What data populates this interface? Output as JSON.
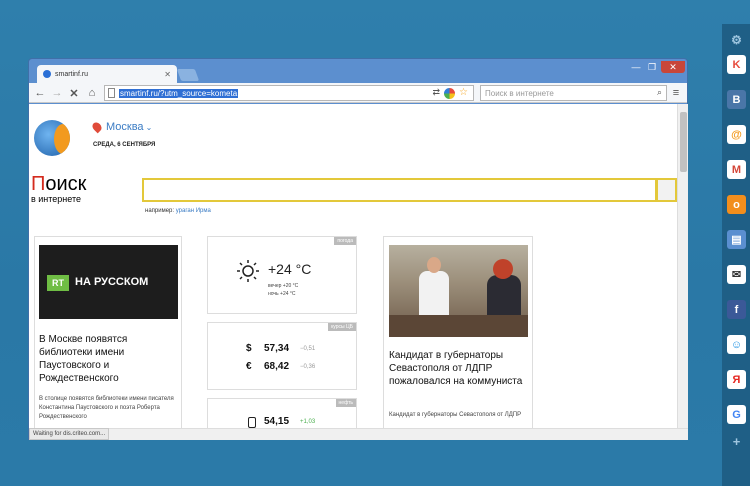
{
  "browser": {
    "tab_title": "smartinf.ru",
    "url_selected": "smartinf.ru/?utm_source=kometa",
    "search_placeholder": "Поиск в интернете",
    "status_text": "Waiting for dis.criteo.com..."
  },
  "page": {
    "city": "Москва",
    "date": "СРЕДА, 6 СЕНТЯБРЯ",
    "search_logo_main": "оиск",
    "search_logo_first": "П",
    "search_logo_sub": "в интернете",
    "example_label": "например:",
    "example_link": "ураган Ирма"
  },
  "news1": {
    "badge_text": "НА РУССКОМ",
    "badge_logo": "RT",
    "headline": "В Москве появятся библиотеки имени Паустовского и Рождественского",
    "lead": "В столице появятся библиотеки имени писателя Константина Паустовского и поэта Роберта Рождественского"
  },
  "weather": {
    "tag": "погода",
    "temp": "+24 °C",
    "evening": "вечер +20 °C",
    "night": "ночь +24 °C"
  },
  "currency": {
    "tag": "курсы ЦБ",
    "usd_symbol": "$",
    "usd_value": "57,34",
    "usd_delta": "−0,51",
    "eur_symbol": "€",
    "eur_value": "68,42",
    "eur_delta": "−0,36"
  },
  "oil": {
    "tag": "нефть",
    "value": "54,15",
    "delta": "+1,03"
  },
  "news2": {
    "headline": "Кандидат в губернаторы Севастополя от ЛДПР пожаловался на коммуниста",
    "lead": "Кандидат в губернаторы Севастополя от ЛДПР"
  },
  "dock": {
    "items": [
      "gear-icon",
      "kometa-icon",
      "vk-icon",
      "mail-icon",
      "gmail-icon",
      "ok-icon",
      "chat-icon",
      "inbox-icon",
      "facebook-icon",
      "mir-icon",
      "yandex-icon",
      "google-icon",
      "plus-icon"
    ],
    "labels": [
      "⚙",
      "K",
      "В",
      "@",
      "M",
      "о",
      "▤",
      "✉",
      "f",
      "☺",
      "Я",
      "G",
      "+"
    ]
  },
  "colors": {
    "accent": "#3b7cc4",
    "search_border": "#e3c83a",
    "logo_red": "#d42b1e",
    "desktop": "#2a7aa7"
  }
}
